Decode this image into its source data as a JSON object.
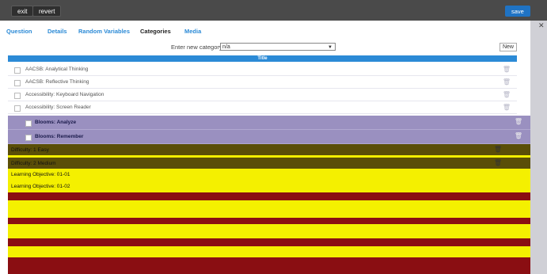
{
  "toolbar": {
    "exit_label": "exit",
    "revert_label": "revert",
    "save_label": "save"
  },
  "tabs": [
    {
      "label": "Question"
    },
    {
      "label": "Details"
    },
    {
      "label": "Random Variables"
    },
    {
      "label": "Categories"
    },
    {
      "label": "Media"
    }
  ],
  "category": {
    "label": "Enter new category title:",
    "selected": "n/a",
    "new_label": "New"
  },
  "table": {
    "header": "Title"
  },
  "rows": [
    {
      "title": "AACSB: Analytical Thinking"
    },
    {
      "title": "AACSB: Reflective Thinking"
    },
    {
      "title": "Accessibility: Keyboard Navigation"
    },
    {
      "title": "Accessibility: Screen Reader"
    }
  ],
  "subrows": [
    {
      "title": "Blooms: Analyze"
    },
    {
      "title": "Blooms: Remember"
    }
  ],
  "overlay_rows": [
    {
      "title": "Difficulty: 1 Easy"
    },
    {
      "title": "Difficulty: 2 Medium"
    },
    {
      "title": "Learning Objective: 01-01"
    },
    {
      "title": "Learning Objective: 01-02"
    }
  ],
  "colors": {
    "accent": "#2b8ad6",
    "toolbar": "#4a4a4a",
    "save": "#1f73c4",
    "subrow": "#9a90c0"
  }
}
